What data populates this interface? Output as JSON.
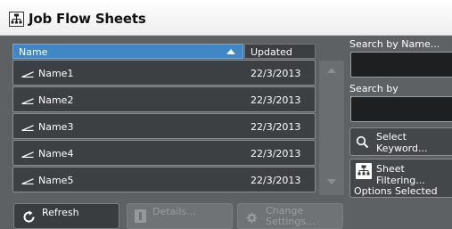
{
  "window": {
    "title": "Job Flow Sheets"
  },
  "list": {
    "columns": {
      "name": "Name",
      "updated": "Updated"
    },
    "rows": [
      {
        "name": "Name1",
        "updated": "22/3/2013"
      },
      {
        "name": "Name2",
        "updated": "22/3/2013"
      },
      {
        "name": "Name3",
        "updated": "22/3/2013"
      },
      {
        "name": "Name4",
        "updated": "22/3/2013"
      },
      {
        "name": "Name5",
        "updated": "22/3/2013"
      }
    ]
  },
  "search": {
    "by_name_label": "Search by Name...",
    "name_value": "",
    "by_keyword_label": "Search by Keyword...",
    "keyword_value": "",
    "select_keyword_line1": "Select",
    "select_keyword_line2": "Keyword...",
    "sheet_filtering": "Sheet Filtering...",
    "options_selected": "Options Selected"
  },
  "buttons": {
    "refresh": "Refresh",
    "details": "Details...",
    "change_settings_line1": "Change",
    "change_settings_line2": "Settings..."
  },
  "colors": {
    "header_accent": "#3f87c7",
    "panel_bg": "#5d6163",
    "row_bg": "#3d4042"
  }
}
